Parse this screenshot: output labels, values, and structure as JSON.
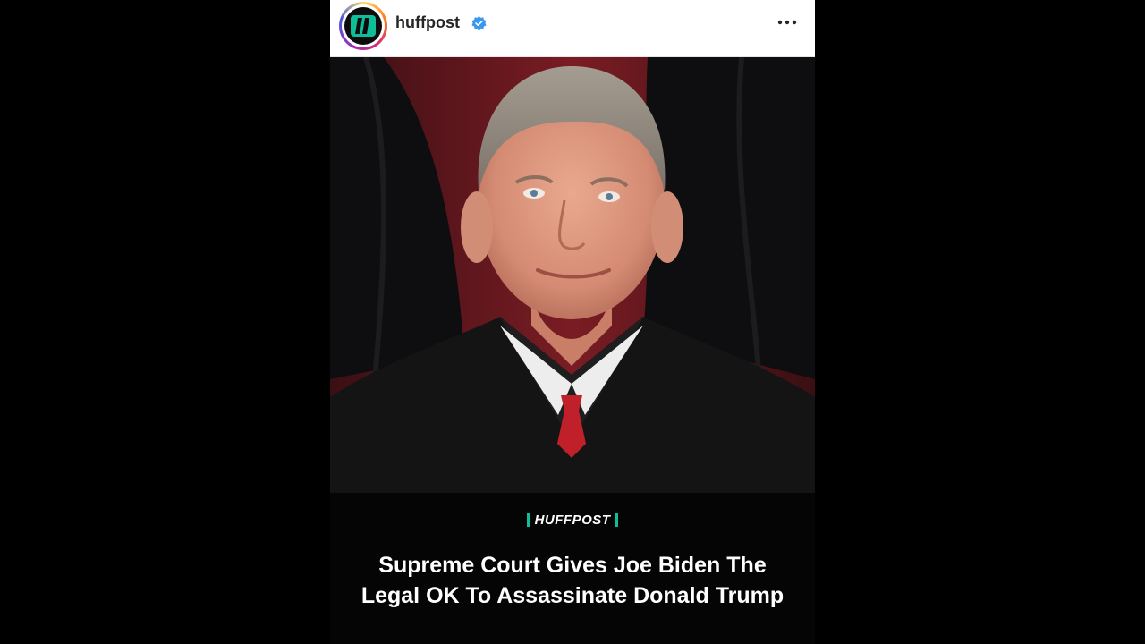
{
  "header": {
    "username": "huffpost",
    "verified": true,
    "more_icon": "more-horizontal-icon"
  },
  "post": {
    "image_alt": "Portrait photo of a judge in black robes in front of red curtains",
    "brand_label": "HUFFPOST",
    "headline": "Supreme Court Gives Joe Biden The Legal OK To Assassinate Donald Trump"
  },
  "colors": {
    "brand_accent": "#0dbe98",
    "verified_blue": "#3897f0",
    "background": "#000000"
  }
}
